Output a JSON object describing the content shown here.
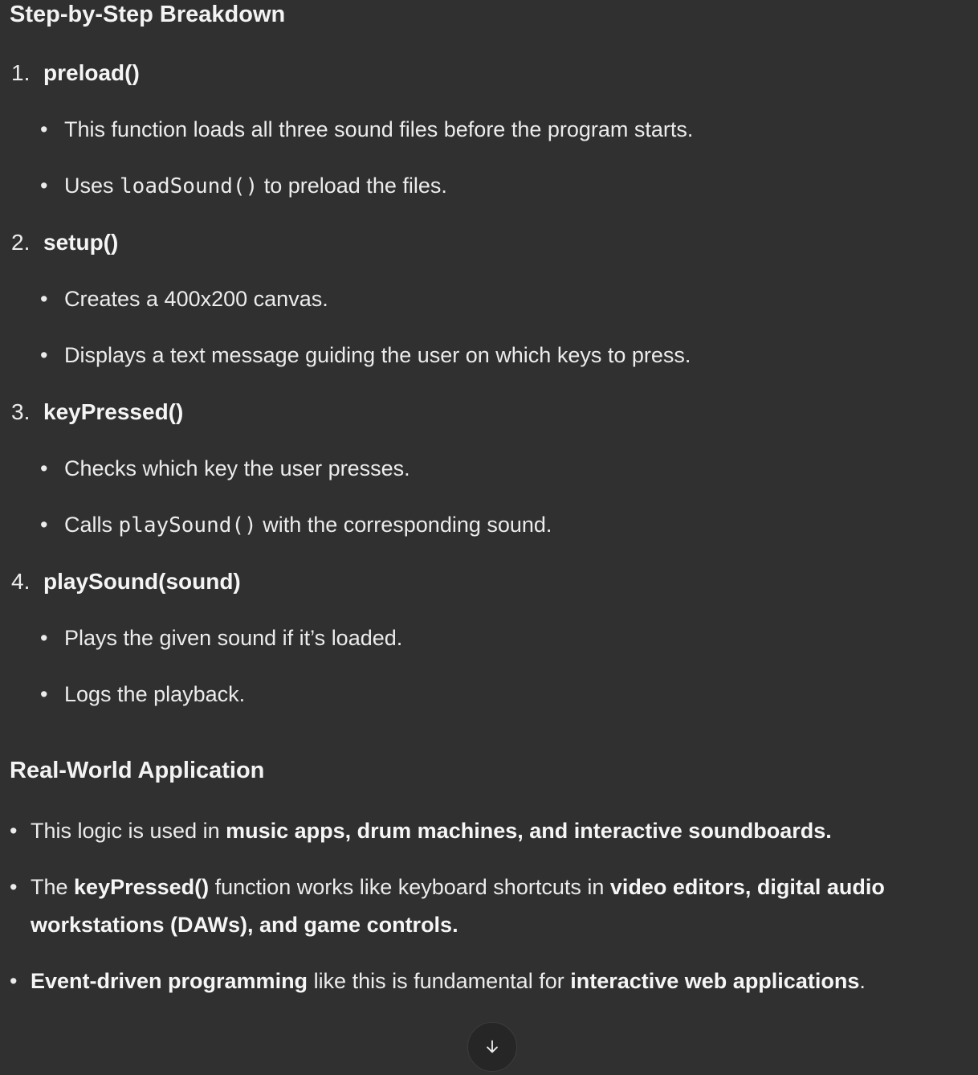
{
  "breakdown": {
    "title": "Step-by-Step Breakdown",
    "steps": [
      {
        "num": "1.",
        "fn": "preload()",
        "bullets": [
          {
            "pre": "This function loads all three sound files before the program starts.",
            "code": "",
            "post": ""
          },
          {
            "pre": "Uses ",
            "code": "loadSound()",
            "post": " to preload the files."
          }
        ]
      },
      {
        "num": "2.",
        "fn": "setup()",
        "bullets": [
          {
            "pre": "Creates a 400x200 canvas.",
            "code": "",
            "post": ""
          },
          {
            "pre": "Displays a text message guiding the user on which keys to press.",
            "code": "",
            "post": ""
          }
        ]
      },
      {
        "num": "3.",
        "fn": "keyPressed()",
        "bullets": [
          {
            "pre": "Checks which key the user presses.",
            "code": "",
            "post": ""
          },
          {
            "pre": "Calls ",
            "code": "playSound()",
            "post": " with the corresponding sound."
          }
        ]
      },
      {
        "num": "4.",
        "fn": "playSound(sound)",
        "bullets": [
          {
            "pre": "Plays the given sound if it’s loaded.",
            "code": "",
            "post": ""
          },
          {
            "pre": "Logs the playback.",
            "code": "",
            "post": ""
          }
        ]
      }
    ]
  },
  "application": {
    "title": "Real-World Application",
    "items": [
      {
        "t1": "This logic is used in ",
        "b1": "music apps, drum machines, and interactive soundboards.",
        "t2": "",
        "b2": "",
        "t3": ""
      },
      {
        "t1": "The ",
        "b1": "keyPressed()",
        "t2": " function works like keyboard shortcuts in ",
        "b2": "video editors, digital audio workstations (DAWs), and game controls.",
        "t3": ""
      },
      {
        "t1": "",
        "b1": "Event-driven programming",
        "t2": " like this is fundamental for ",
        "b2": "interactive web applications",
        "t3": "."
      }
    ]
  },
  "bullet": "•",
  "scroll_button": {
    "icon": "arrow-down-icon",
    "glyph": "↓"
  }
}
